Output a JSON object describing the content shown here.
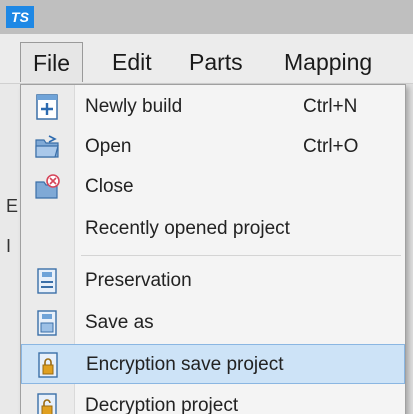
{
  "app": {
    "logo_text": "TS"
  },
  "menubar": {
    "items": [
      {
        "label": "File",
        "active": true
      },
      {
        "label": "Edit"
      },
      {
        "label": "Parts"
      },
      {
        "label": "Mapping"
      }
    ]
  },
  "left_strip": {
    "marks": [
      "E",
      "I"
    ]
  },
  "file_menu": {
    "items": [
      {
        "label": "Newly build",
        "shortcut": "Ctrl+N",
        "icon": "new-file-icon"
      },
      {
        "label": "Open",
        "shortcut": "Ctrl+O",
        "icon": "open-folder-icon"
      },
      {
        "label": "Close",
        "shortcut": "",
        "icon": "close-folder-icon"
      },
      {
        "label": "Recently opened project",
        "shortcut": "",
        "icon": ""
      },
      {
        "label": "Preservation",
        "shortcut": "",
        "icon": "save-icon"
      },
      {
        "label": "Save as",
        "shortcut": "",
        "icon": "save-as-icon"
      },
      {
        "label": "Encryption save project",
        "shortcut": "",
        "icon": "encrypt-icon",
        "highlighted": true
      },
      {
        "label": "Decryption project",
        "shortcut": "",
        "icon": "decrypt-icon"
      }
    ]
  },
  "colors": {
    "highlight_bg": "#cde3f7",
    "highlight_border": "#8ab6e2",
    "logo_bg": "#1e88e5"
  }
}
